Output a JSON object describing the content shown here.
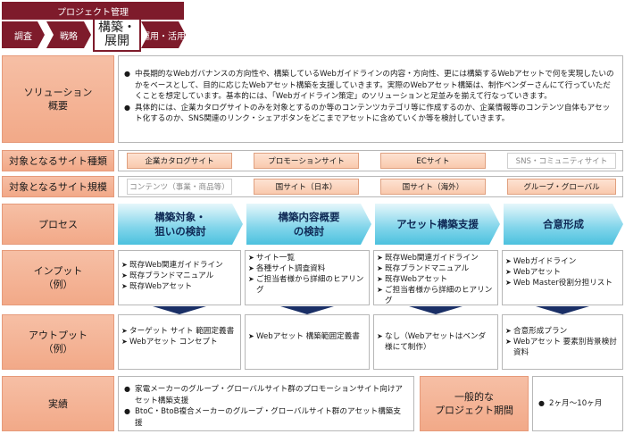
{
  "header": {
    "project_management": "プロジェクト管理",
    "phases": [
      "調査",
      "戦略",
      "構築・展開",
      "運用・活用"
    ]
  },
  "solution": {
    "label": "ソリューション\n概要",
    "bullets": [
      "中長期的なWebガバナンスの方向性や、構築しているWebガイドラインの内容・方向性、更には構築するWebアセットで何を実現したいのかをベースとして、目的に応じたWebアセット構築を支援していきます。実際のWebアセット構築は、制作ベンダーさんにて行っていただくことを想定しています。基本的には、「Webガイドライン策定」のソリューションと足並みを揃えて行なっていきます。",
      "具体的には、企業カタログサイトのみを対象とするのか等のコンテンツカテゴリ等に作成するのか、企業情報等のコンテンツ自体もアセット化するのか、SNS関連のリンク・シェアボタンをどこまでアセットに含めていくか等を検討していきます。"
    ]
  },
  "site_types": {
    "label": "対象となるサイト種類",
    "items": [
      "企業カタログサイト",
      "プロモーションサイト",
      "ECサイト",
      "SNS・コミュニティサイト"
    ]
  },
  "site_scale": {
    "label": "対象となるサイト規模",
    "items": [
      "コンテンツ（事業・商品等）",
      "国サイト（日本）",
      "国サイト（海外）",
      "グループ・グローバル"
    ]
  },
  "process": {
    "label": "プロセス",
    "steps": [
      "構築対象・\n狙いの検討",
      "構築内容概要\nの検討",
      "アセット構築支援",
      "合意形成"
    ]
  },
  "input": {
    "label": "インプット\n（例）",
    "columns": [
      [
        "既存Web関連ガイドライン",
        "既存ブランドマニュアル",
        "既存Webアセット"
      ],
      [
        "サイト一覧",
        "各種サイト調査資料",
        "ご担当者様から詳細のヒアリング"
      ],
      [
        "既存Web関連ガイドライン",
        "既存ブランドマニュアル",
        "既存Webアセット",
        "ご担当者様から詳細のヒアリング"
      ],
      [
        "Webガイドライン",
        "Webアセット",
        "Web Master役割分担リスト"
      ]
    ]
  },
  "output": {
    "label": "アウトプット\n（例）",
    "columns": [
      [
        "ターゲット サイト 範囲定義書",
        "Webアセット コンセプト"
      ],
      [
        "Webアセット 構築範囲定義書"
      ],
      [
        "なし（Webアセットはベンダ 様にて制作）"
      ],
      [
        "合意形成プラン",
        "Webアセット 要素別背景検討資料"
      ]
    ]
  },
  "results": {
    "label": "実績",
    "bullets": [
      "家電メーカーのグループ・グローバルサイト群のプロモーションサイト向けアセット構築支援",
      "BtoC・BtoB複合メーカーのグループ・グローバルサイト群のアセット構築支援"
    ],
    "period_label": "一般的な\nプロジェクト期間",
    "period_value": "2ヶ月～10ヶ月"
  },
  "colors": {
    "phase_bar": "#7e1b2b",
    "label_bg": "#f2a988",
    "process_arrow": "#4cc1de",
    "down_arrow": "#1a2f66"
  }
}
